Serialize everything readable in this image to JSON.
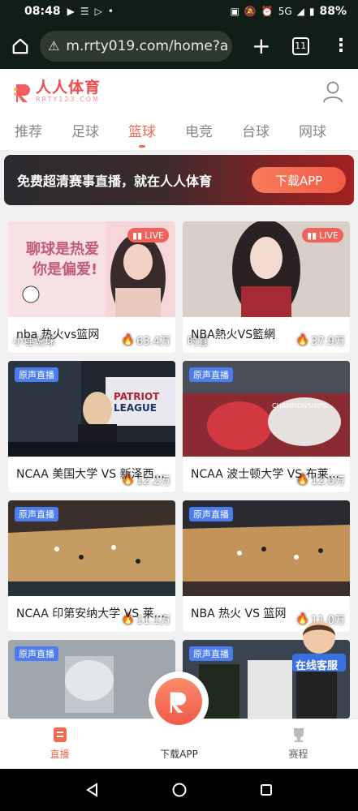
{
  "status_bar": {
    "time": "08:48",
    "network": "5G",
    "battery": "88%"
  },
  "browser": {
    "url": "m.rrty019.com/home?a",
    "tab_count": "11"
  },
  "header": {
    "logo_cn": "人人体育",
    "logo_en": "RRTY123.COM"
  },
  "nav": {
    "tabs": [
      "推荐",
      "足球",
      "篮球",
      "电竞",
      "台球",
      "网球"
    ],
    "active_index": 2
  },
  "banner": {
    "text": "免费超清赛事直播，就在人人体育",
    "button": "下载APP"
  },
  "cards": [
    {
      "badge": "LIVE",
      "streamer": "小埋说球",
      "views": "63.4万",
      "title": "nba 热火vs篮网"
    },
    {
      "badge": "LIVE",
      "streamer": "时宜",
      "views": "37.9万",
      "title": "NBA熱火VS籃網"
    },
    {
      "badge": "原声直播",
      "streamer": "",
      "views": "12.2万",
      "title": "NCAA 美国大学 VS 新泽西..."
    },
    {
      "badge": "原声直播",
      "streamer": "",
      "views": "12.0万",
      "title": "NCAA 波士顿大学 VS 布莱..."
    },
    {
      "badge": "原声直播",
      "streamer": "",
      "views": "11.1万",
      "title": "NCAA 印第安纳大学 VS 莱..."
    },
    {
      "badge": "原声直播",
      "streamer": "",
      "views": "11.0万",
      "title": "NBA 热火 VS 篮网"
    },
    {
      "badge": "原声直播",
      "streamer": "",
      "views": "",
      "title": ""
    },
    {
      "badge": "原声直播",
      "streamer": "",
      "views": "",
      "title": ""
    }
  ],
  "customer_service": {
    "label": "在线客服"
  },
  "tabbar": {
    "live": "直播",
    "download": "下载APP",
    "schedule": "赛程"
  },
  "colors": {
    "accent": "#f26a50",
    "live_badge": "#f0625a",
    "source_badge": "#4b7df0"
  }
}
